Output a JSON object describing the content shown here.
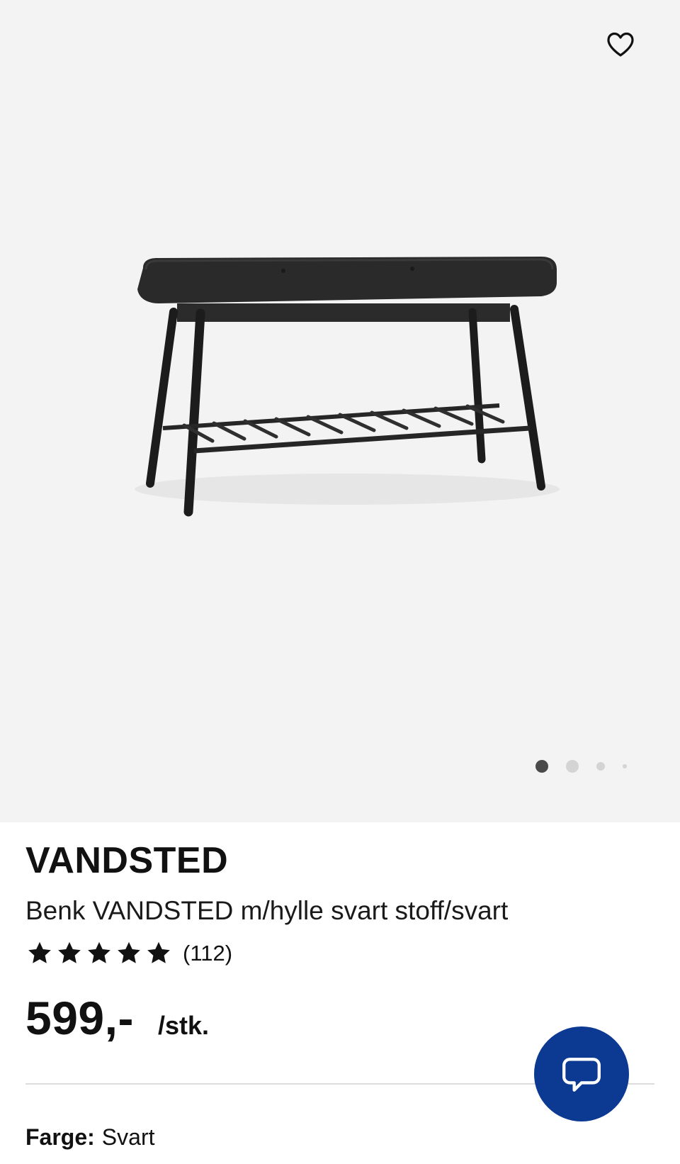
{
  "product": {
    "brand": "VANDSTED",
    "description": "Benk VANDSTED m/hylle svart stoff/svart",
    "rating": {
      "stars": 5,
      "count_label": "(112)"
    },
    "price": "599,-",
    "price_unit": "/stk.",
    "color_label": "Farge:",
    "color_value": "Svart"
  },
  "gallery": {
    "image_count": 4,
    "active_index": 0
  },
  "icons": {
    "favorite": "heart-outline-icon",
    "chat": "chat-bubble-icon",
    "star": "star-icon"
  },
  "colors": {
    "hero_background": "#f3f3f3",
    "chat_button": "#0c3991",
    "text": "#111111"
  }
}
